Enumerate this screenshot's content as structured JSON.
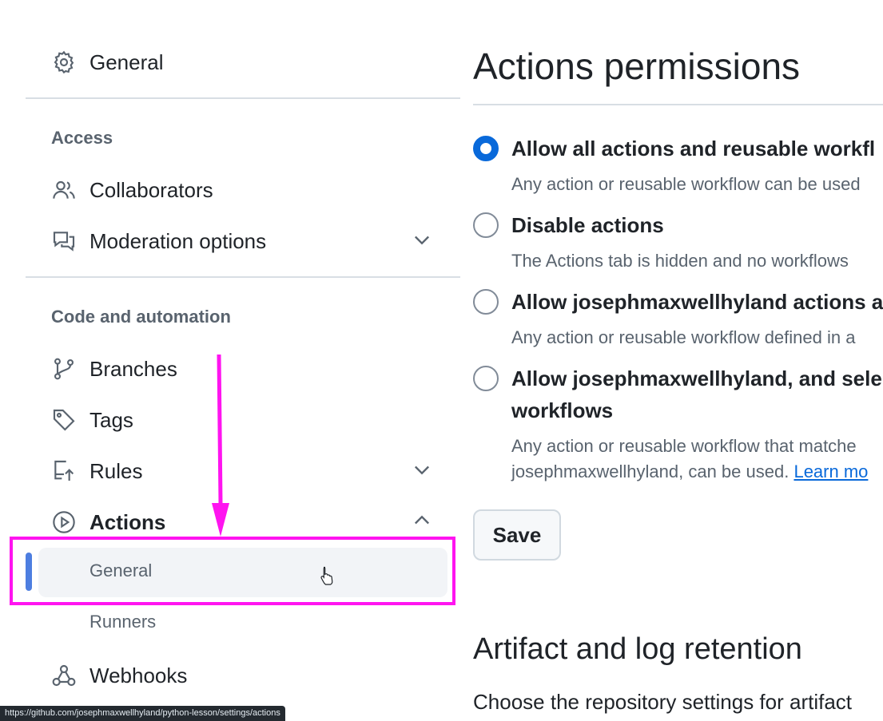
{
  "sidebar": {
    "general": "General",
    "access_heading": "Access",
    "collaborators": "Collaborators",
    "moderation": "Moderation options",
    "code_heading": "Code and automation",
    "branches": "Branches",
    "tags": "Tags",
    "rules": "Rules",
    "actions": "Actions",
    "actions_sub": [
      "General",
      "Runners"
    ],
    "webhooks": "Webhooks"
  },
  "status_url": "https://github.com/josephmaxwellhyland/python-lesson/settings/actions",
  "main": {
    "title": "Actions permissions",
    "options": [
      {
        "title": "Allow all actions and reusable workfl",
        "desc": "Any action or reusable workflow can be used",
        "checked": true
      },
      {
        "title": "Disable actions",
        "desc": "The Actions tab is hidden and no workflows",
        "checked": false
      },
      {
        "title": "Allow josephmaxwellhyland actions a",
        "desc": "Any action or reusable workflow defined in a",
        "checked": false
      },
      {
        "title": "Allow josephmaxwellhyland, and sele",
        "title2": "workflows",
        "desc": "Any action or reusable workflow that matche",
        "desc2": "josephmaxwellhyland, can be used.",
        "link": "Learn mo",
        "checked": false
      }
    ],
    "save_label": "Save",
    "section2_title": "Artifact and log retention",
    "section2_text": "Choose the repository settings for artifact"
  },
  "colors": {
    "accent": "#0969da",
    "annotation": "#ff14f0",
    "active_bar": "#4d7ee0"
  }
}
